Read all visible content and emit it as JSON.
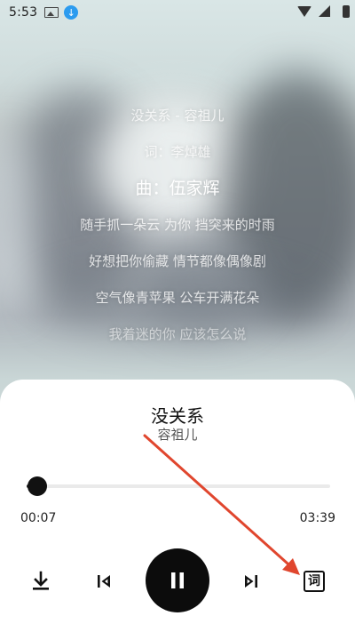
{
  "status_bar": {
    "time": "5:53",
    "download_badge": "↓"
  },
  "lyrics": [
    {
      "text": "没关系 - 容祖儿",
      "state": "normal"
    },
    {
      "text": "词：李焯雄",
      "state": "normal"
    },
    {
      "text": "曲：伍家辉",
      "state": "active"
    },
    {
      "text": "随手抓一朵云 为你 挡突来的时雨",
      "state": "normal"
    },
    {
      "text": "好想把你偷藏 情节都像偶像剧",
      "state": "normal"
    },
    {
      "text": "空气像青苹果 公车开满花朵",
      "state": "normal"
    },
    {
      "text": "我着迷的你 应该怎么说",
      "state": "fade"
    }
  ],
  "player": {
    "title": "没关系",
    "artist": "容祖儿",
    "current_time": "00:07",
    "total_time": "03:39",
    "progress": 0.034,
    "lyric_button_label": "词"
  },
  "colors": {
    "annotation_arrow": "#e0462e",
    "play_button": "#0c0c0c"
  },
  "icons": [
    "download-icon",
    "skip-previous-icon",
    "pause-icon",
    "skip-next-icon",
    "lyrics-icon",
    "wifi-icon",
    "signal-icon",
    "battery-icon",
    "gallery-icon"
  ]
}
